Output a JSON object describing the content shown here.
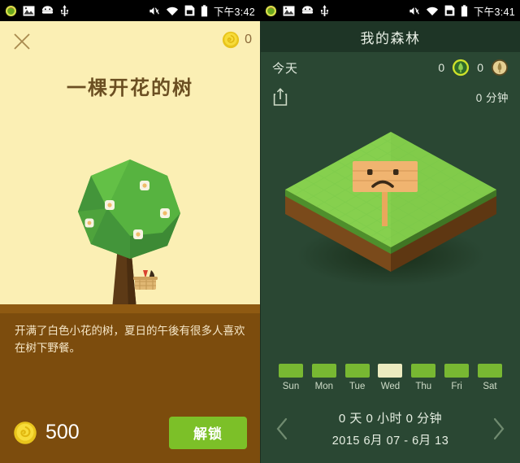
{
  "left": {
    "statusbar": {
      "time": "下午3:42",
      "left_icons": [
        "browser-icon",
        "gallery-icon",
        "android-icon",
        "usb-icon"
      ],
      "right_icons": [
        "mute-icon",
        "wifi-icon",
        "sdcard-icon",
        "battery-icon"
      ]
    },
    "close_icon": "close-icon",
    "coin_icon": "coin-icon",
    "coin_count": "0",
    "title": "一棵开花的树",
    "description": "开满了白色小花的树，夏日的午後有很多人喜欢在树下野餐。",
    "price_icon": "coin-icon",
    "price": "500",
    "unlock_label": "解锁",
    "colors": {
      "background": "#fbefb4",
      "ground": "#7c4c0d",
      "ground_lip": "#8f5a12",
      "title_text": "#6b4f22",
      "unlock_button": "#7cc028",
      "coin": "#f2d127"
    }
  },
  "right": {
    "statusbar": {
      "time": "下午3:41",
      "left_icons": [
        "browser-icon",
        "gallery-icon",
        "android-icon",
        "usb-icon"
      ],
      "right_icons": [
        "mute-icon",
        "wifi-icon",
        "sdcard-icon",
        "battery-icon"
      ]
    },
    "title": "我的森林",
    "today_label": "今天",
    "tree_alive_count": "0",
    "tree_alive_icon": "green-tree-badge-icon",
    "tree_dead_count": "0",
    "tree_dead_icon": "tan-tree-badge-icon",
    "share_icon": "share-icon",
    "minutes_today": "0 分钟",
    "island_sign_icon": "sad-face-sign-icon",
    "days": [
      {
        "label": "Sun",
        "active": false
      },
      {
        "label": "Mon",
        "active": false
      },
      {
        "label": "Tue",
        "active": false
      },
      {
        "label": "Wed",
        "active": true
      },
      {
        "label": "Thu",
        "active": false
      },
      {
        "label": "Fri",
        "active": false
      },
      {
        "label": "Sat",
        "active": false
      }
    ],
    "prev_icon": "chevron-left-icon",
    "next_icon": "chevron-right-icon",
    "duration": "0 天 0 小时 0 分钟",
    "date_range": "2015 6月 07 - 6月 13",
    "colors": {
      "background": "#2a4733",
      "titlebar": "#1e3526",
      "bar_active": "#ecebc0",
      "bar_inactive": "#78b832"
    }
  }
}
